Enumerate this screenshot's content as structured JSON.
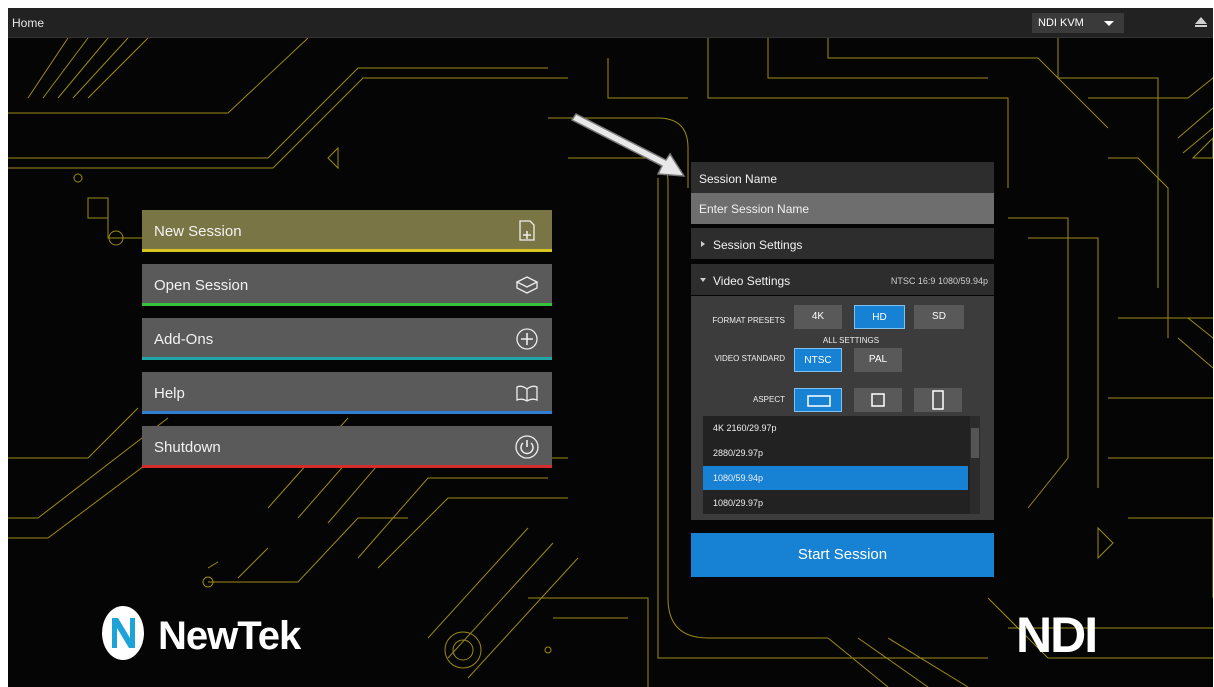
{
  "titlebar": {
    "home": "Home",
    "kvm": "NDI KVM"
  },
  "menu": {
    "items": [
      {
        "label": "New Session",
        "color": "#d6c421",
        "icon": "new-document-icon"
      },
      {
        "label": "Open Session",
        "color": "#35c23a",
        "icon": "open-box-icon"
      },
      {
        "label": "Add-Ons",
        "color": "#1fa6a6",
        "icon": "plus-circle-icon"
      },
      {
        "label": "Help",
        "color": "#2e7fd1",
        "icon": "book-icon"
      },
      {
        "label": "Shutdown",
        "color": "#d42b2b",
        "icon": "power-icon"
      }
    ]
  },
  "session": {
    "name_label": "Session Name",
    "name_placeholder": "Enter Session Name",
    "settings_label": "Session Settings",
    "video_label": "Video Settings",
    "video_summary": "NTSC 16:9 1080/59.94p",
    "format_presets_label": "FORMAT PRESETS",
    "presets": [
      "4K",
      "HD",
      "SD"
    ],
    "selected_preset": "HD",
    "all_settings_label": "ALL SETTINGS",
    "video_standard_label": "VIDEO STANDARD",
    "standards": [
      "NTSC",
      "PAL"
    ],
    "selected_standard": "NTSC",
    "aspect_label": "ASPECT",
    "resolutions": [
      "4K 2160/29.97p",
      "2880/29.97p",
      "1080/59.94p",
      "1080/29.97p"
    ],
    "selected_resolution": "1080/59.94p",
    "start_label": "Start Session"
  },
  "logos": {
    "newtek": "NewTek",
    "ndi": "NDI"
  },
  "colors": {
    "accent": "#1782d4",
    "circuit": "#c9b520"
  }
}
